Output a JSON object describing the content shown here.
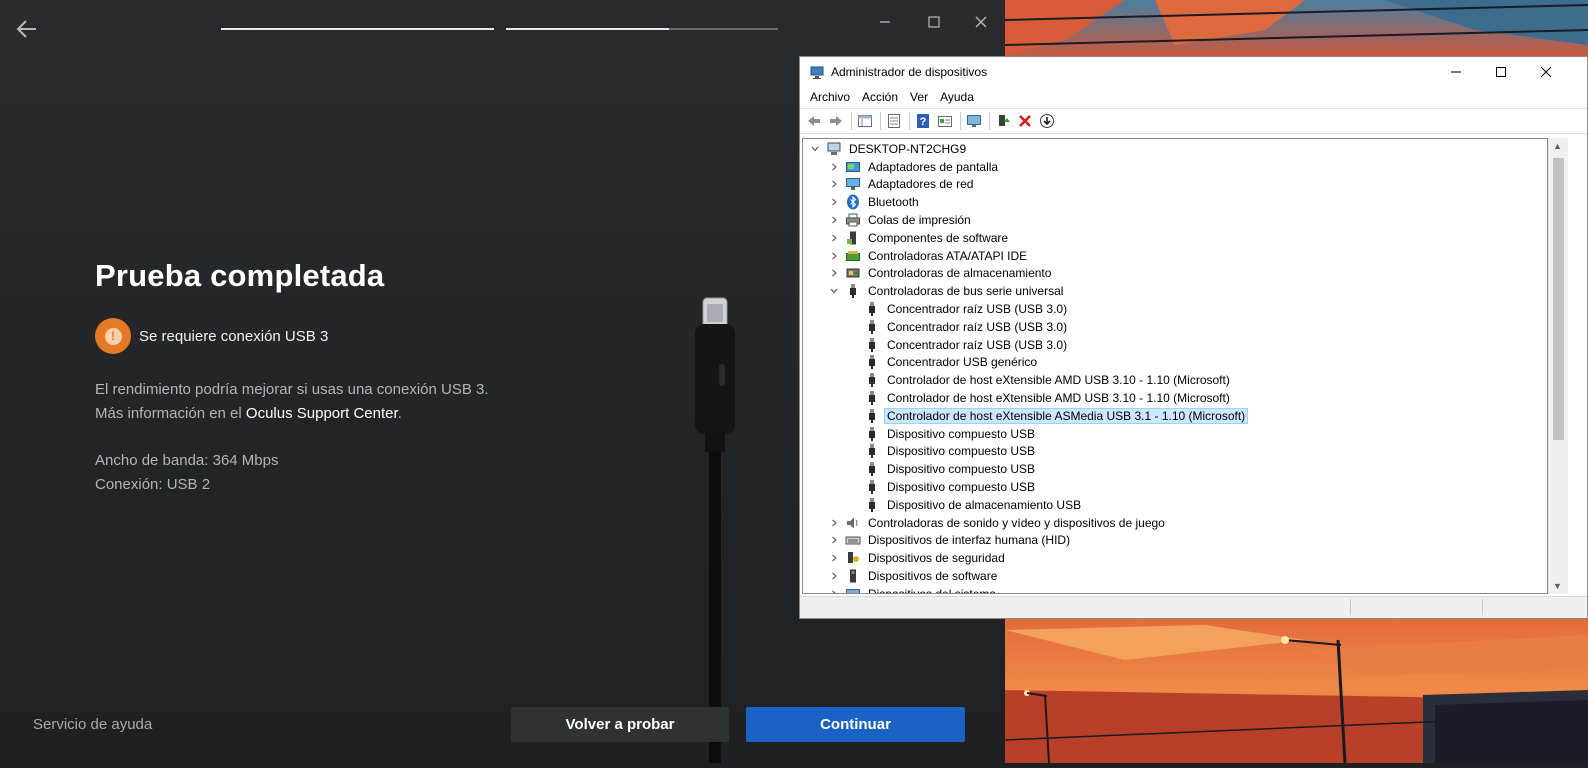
{
  "oculus": {
    "title": "Prueba completada",
    "warning": "Se requiere conexión USB 3",
    "desc_line1": "El rendimiento podría mejorar si usas una conexión USB 3.",
    "desc_line2_prefix": "Más información en el ",
    "desc_link": "Oculus Support Center",
    "desc_line2_suffix": ".",
    "bandwidth": "Ancho de banda: 364 Mbps",
    "connection": "Conexión: USB 2",
    "help_link": "Servicio de ayuda",
    "retry_button": "Volver a probar",
    "continue_button": "Continuar",
    "progress_steps": [
      1.0,
      0.6
    ],
    "colors": {
      "warning": "#e47a25",
      "primary": "#1a63c5"
    }
  },
  "devmgr": {
    "title": "Administrador de dispositivos",
    "menu": [
      "Archivo",
      "Acción",
      "Ver",
      "Ayuda"
    ],
    "toolbar_icons": [
      "back-arrow-icon",
      "forward-arrow-icon",
      "properties-grid-icon",
      "update-list-icon",
      "help-icon",
      "device-view-icon",
      "monitor-scan-icon",
      "enable-device-icon",
      "uninstall-x-icon",
      "download-icon"
    ],
    "tree": [
      {
        "label": "DESKTOP-NT2CHG9",
        "level": 0,
        "expander": "open",
        "icon": "computer-icon"
      },
      {
        "label": "Adaptadores de pantalla",
        "level": 1,
        "expander": "closed",
        "icon": "display-adapter-icon"
      },
      {
        "label": "Adaptadores de red",
        "level": 1,
        "expander": "closed",
        "icon": "network-adapter-icon"
      },
      {
        "label": "Bluetooth",
        "level": 1,
        "expander": "closed",
        "icon": "bluetooth-icon"
      },
      {
        "label": "Colas de impresión",
        "level": 1,
        "expander": "closed",
        "icon": "printer-icon"
      },
      {
        "label": "Componentes de software",
        "level": 1,
        "expander": "closed",
        "icon": "software-component-icon"
      },
      {
        "label": "Controladoras ATA/ATAPI IDE",
        "level": 1,
        "expander": "closed",
        "icon": "ide-controller-icon"
      },
      {
        "label": "Controladoras de almacenamiento",
        "level": 1,
        "expander": "closed",
        "icon": "storage-controller-icon"
      },
      {
        "label": "Controladoras de bus serie universal",
        "level": 1,
        "expander": "open",
        "icon": "usb-plug-icon"
      },
      {
        "label": "Concentrador raíz USB (USB 3.0)",
        "level": 2,
        "expander": "none",
        "icon": "usb-plug-icon"
      },
      {
        "label": "Concentrador raíz USB (USB 3.0)",
        "level": 2,
        "expander": "none",
        "icon": "usb-plug-icon"
      },
      {
        "label": "Concentrador raíz USB (USB 3.0)",
        "level": 2,
        "expander": "none",
        "icon": "usb-plug-icon"
      },
      {
        "label": "Concentrador USB genérico",
        "level": 2,
        "expander": "none",
        "icon": "usb-plug-icon"
      },
      {
        "label": "Controlador de host eXtensible AMD USB 3.10 - 1.10 (Microsoft)",
        "level": 2,
        "expander": "none",
        "icon": "usb-plug-icon"
      },
      {
        "label": "Controlador de host eXtensible AMD USB 3.10 - 1.10 (Microsoft)",
        "level": 2,
        "expander": "none",
        "icon": "usb-plug-icon"
      },
      {
        "label": "Controlador de host eXtensible ASMedia USB 3.1 - 1.10 (Microsoft)",
        "level": 2,
        "expander": "none",
        "icon": "usb-plug-icon",
        "selected": true
      },
      {
        "label": "Dispositivo compuesto USB",
        "level": 2,
        "expander": "none",
        "icon": "usb-plug-icon"
      },
      {
        "label": "Dispositivo compuesto USB",
        "level": 2,
        "expander": "none",
        "icon": "usb-plug-icon"
      },
      {
        "label": "Dispositivo compuesto USB",
        "level": 2,
        "expander": "none",
        "icon": "usb-plug-icon"
      },
      {
        "label": "Dispositivo compuesto USB",
        "level": 2,
        "expander": "none",
        "icon": "usb-plug-icon"
      },
      {
        "label": "Dispositivo de almacenamiento USB",
        "level": 2,
        "expander": "none",
        "icon": "usb-plug-icon"
      },
      {
        "label": "Controladoras de sonido y vídeo y dispositivos de juego",
        "level": 1,
        "expander": "closed",
        "icon": "speaker-icon"
      },
      {
        "label": "Dispositivos de interfaz humana (HID)",
        "level": 1,
        "expander": "closed",
        "icon": "keyboard-hid-icon"
      },
      {
        "label": "Dispositivos de seguridad",
        "level": 1,
        "expander": "closed",
        "icon": "security-key-icon"
      },
      {
        "label": "Dispositivos de software",
        "level": 1,
        "expander": "closed",
        "icon": "software-device-icon"
      },
      {
        "label": "Dispositivos del sistema",
        "level": 1,
        "expander": "closed",
        "icon": "system-device-icon"
      }
    ]
  }
}
